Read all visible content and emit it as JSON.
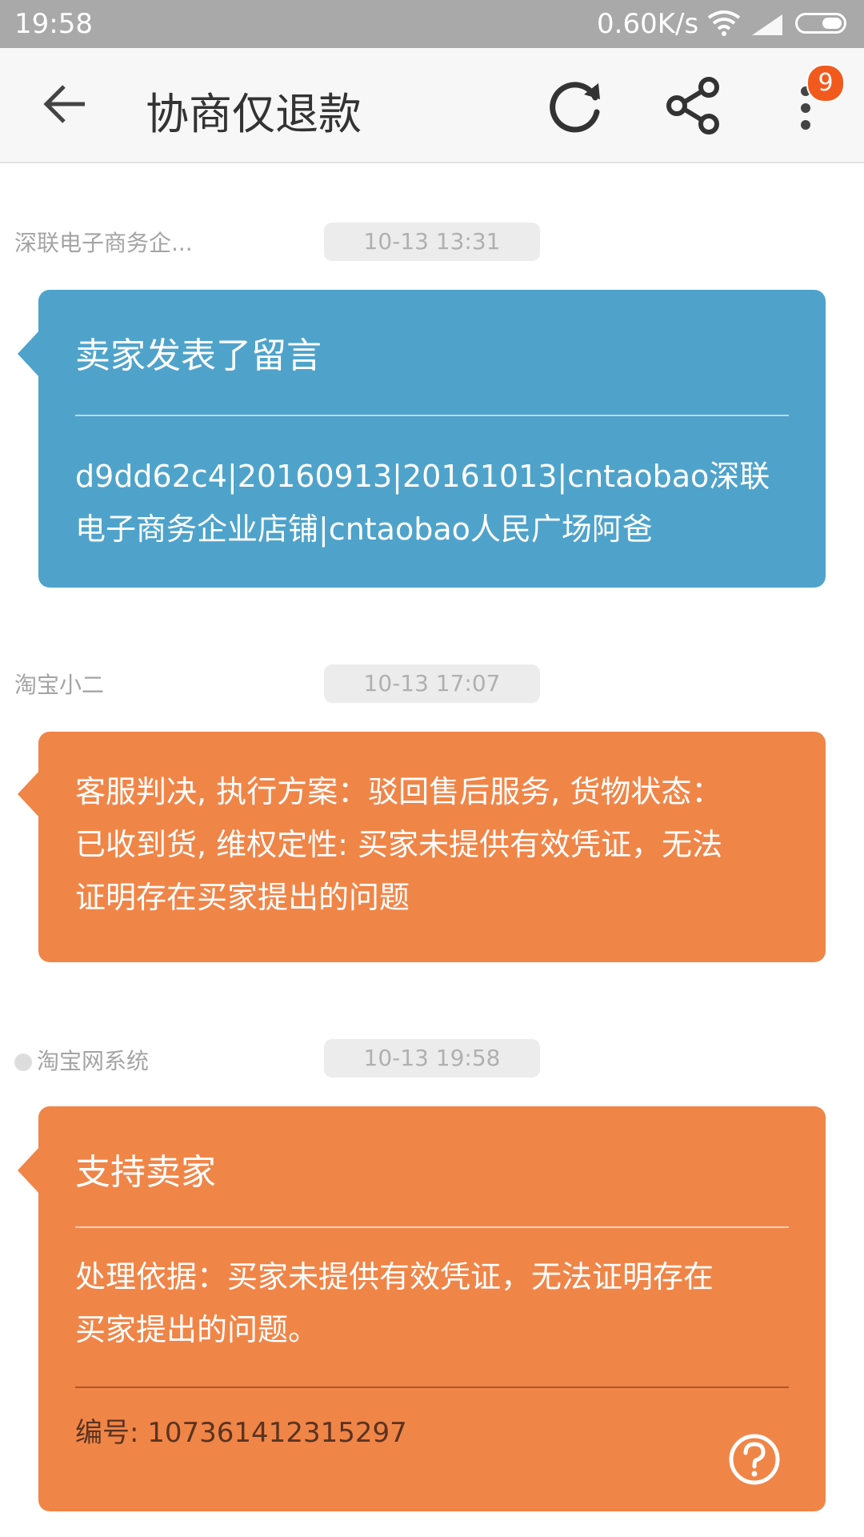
{
  "status_bar": {
    "time": "19:58",
    "network_speed": "0.60K/s",
    "icons": [
      "wifi-icon",
      "signal-icon",
      "battery-icon"
    ]
  },
  "header": {
    "title": "协商仅退款",
    "badge_count": "9",
    "icons": [
      "back-arrow-icon",
      "refresh-icon",
      "share-icon",
      "more-icon"
    ]
  },
  "messages": [
    {
      "sender": "深联电子商务企...",
      "timestamp": "10-13 13:31",
      "heading": "卖家发表了留言",
      "body_lines": [
        "d9dd62c4|20160913|20161013|cntaobao深联",
        "电子商务企业店铺|cntaobao人民广场阿爸"
      ]
    },
    {
      "sender": "淘宝小二",
      "timestamp": "10-13 17:07",
      "body_lines": [
        "客服判决, 执行方案：驳回售后服务, 货物状态：",
        "已收到货, 维权定性: 买家未提供有效凭证，无法",
        "证明存在买家提出的问题"
      ]
    },
    {
      "sender": "淘宝网系统",
      "timestamp": "10-13 19:58",
      "heading": "支持卖家",
      "body_lines": [
        "处理依据：买家未提供有效凭证，无法证明存在",
        "买家提出的问题。"
      ],
      "reference": "编号: 107361412315297"
    }
  ],
  "colors": {
    "blue_bubble": "#4fa3cb",
    "orange_bubble": "#f08548",
    "status_bar": "#a9a9a9",
    "badge": "#f25a1d"
  }
}
